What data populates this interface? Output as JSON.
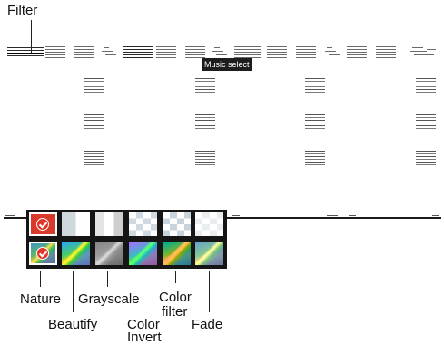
{
  "callouts": {
    "top": "Filter",
    "nature": "Nature",
    "beautify": "Beautify",
    "grayscale": "Grayscale",
    "color_invert_line1": "Color",
    "color_invert_line2": "Invert",
    "color_filter_line1": "Color",
    "color_filter_line2": "filter",
    "fade": "Fade"
  },
  "tooltip": {
    "text": "Music select"
  },
  "toolbar": {
    "icons": [
      "filter-icon",
      "list-icon",
      "list-icon",
      "music-icon",
      "list-icon",
      "list-icon",
      "list-icon",
      "music-icon",
      "list-icon",
      "list-icon",
      "list-icon",
      "music-icon",
      "list-icon",
      "list-icon",
      "music-icon"
    ]
  },
  "filter_strip": {
    "filters": [
      {
        "name": "Nature",
        "selected": true,
        "icon": "check-icon"
      },
      {
        "name": "Beautify",
        "selected": false
      },
      {
        "name": "Grayscale",
        "selected": false
      },
      {
        "name": "Color Invert",
        "selected": false
      },
      {
        "name": "Color filter",
        "selected": false
      },
      {
        "name": "Fade",
        "selected": false
      }
    ]
  },
  "colors": {
    "selected_check": "#e4342a",
    "strip_background": "#151515",
    "tooltip_background": "#1d1d1d"
  }
}
